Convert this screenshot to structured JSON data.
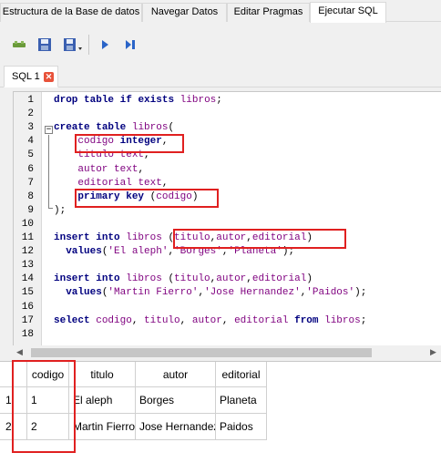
{
  "main_tabs": [
    {
      "label": "Estructura de la Base de datos"
    },
    {
      "label": "Navegar Datos"
    },
    {
      "label": "Editar Pragmas"
    },
    {
      "label": "Ejecutar SQL",
      "active": true
    }
  ],
  "toolbar": {
    "icons": [
      "open-tab-icon",
      "open-sql-icon",
      "save-sql-icon",
      "execute-all-icon",
      "execute-line-icon"
    ]
  },
  "sql_tab": {
    "label": "SQL 1"
  },
  "editor": {
    "line_numbers": [
      "1",
      "2",
      "3",
      "4",
      "5",
      "6",
      "7",
      "8",
      "9",
      "10",
      "11",
      "12",
      "13",
      "14",
      "15",
      "16",
      "17",
      "18"
    ],
    "lines": [
      [
        {
          "t": "drop",
          "c": "kw"
        },
        {
          "t": " "
        },
        {
          "t": "table",
          "c": "kw"
        },
        {
          "t": " "
        },
        {
          "t": "if",
          "c": "kw"
        },
        {
          "t": " "
        },
        {
          "t": "exists",
          "c": "kw"
        },
        {
          "t": " "
        },
        {
          "t": "libros",
          "c": "id"
        },
        {
          "t": ";"
        }
      ],
      [],
      [
        {
          "t": "create",
          "c": "kw"
        },
        {
          "t": " "
        },
        {
          "t": "table",
          "c": "kw"
        },
        {
          "t": " "
        },
        {
          "t": "libros",
          "c": "id"
        },
        {
          "t": "("
        }
      ],
      [
        {
          "t": "    "
        },
        {
          "t": "codigo",
          "c": "id"
        },
        {
          "t": " "
        },
        {
          "t": "integer",
          "c": "kw"
        },
        {
          "t": ","
        }
      ],
      [
        {
          "t": "    "
        },
        {
          "t": "titulo",
          "c": "id"
        },
        {
          "t": " "
        },
        {
          "t": "text",
          "c": "id"
        },
        {
          "t": ","
        }
      ],
      [
        {
          "t": "    "
        },
        {
          "t": "autor",
          "c": "id"
        },
        {
          "t": " "
        },
        {
          "t": "text",
          "c": "id"
        },
        {
          "t": ","
        }
      ],
      [
        {
          "t": "    "
        },
        {
          "t": "editorial",
          "c": "id"
        },
        {
          "t": " "
        },
        {
          "t": "text",
          "c": "id"
        },
        {
          "t": ","
        }
      ],
      [
        {
          "t": "    "
        },
        {
          "t": "primary",
          "c": "kw"
        },
        {
          "t": " "
        },
        {
          "t": "key",
          "c": "kw"
        },
        {
          "t": " ("
        },
        {
          "t": "codigo",
          "c": "id"
        },
        {
          "t": ")"
        }
      ],
      [
        {
          "t": ");"
        }
      ],
      [],
      [
        {
          "t": "insert",
          "c": "kw"
        },
        {
          "t": " "
        },
        {
          "t": "into",
          "c": "kw"
        },
        {
          "t": " "
        },
        {
          "t": "libros",
          "c": "id"
        },
        {
          "t": " ("
        },
        {
          "t": "titulo",
          "c": "id"
        },
        {
          "t": ","
        },
        {
          "t": "autor",
          "c": "id"
        },
        {
          "t": ","
        },
        {
          "t": "editorial",
          "c": "id"
        },
        {
          "t": ")"
        }
      ],
      [
        {
          "t": "  "
        },
        {
          "t": "values",
          "c": "kw"
        },
        {
          "t": "("
        },
        {
          "t": "'El aleph'",
          "c": "str"
        },
        {
          "t": ","
        },
        {
          "t": "'Borges'",
          "c": "str"
        },
        {
          "t": ","
        },
        {
          "t": "'Planeta'",
          "c": "str"
        },
        {
          "t": ");"
        }
      ],
      [],
      [
        {
          "t": "insert",
          "c": "kw"
        },
        {
          "t": " "
        },
        {
          "t": "into",
          "c": "kw"
        },
        {
          "t": " "
        },
        {
          "t": "libros",
          "c": "id"
        },
        {
          "t": " ("
        },
        {
          "t": "titulo",
          "c": "id"
        },
        {
          "t": ","
        },
        {
          "t": "autor",
          "c": "id"
        },
        {
          "t": ","
        },
        {
          "t": "editorial",
          "c": "id"
        },
        {
          "t": ")"
        }
      ],
      [
        {
          "t": "  "
        },
        {
          "t": "values",
          "c": "kw"
        },
        {
          "t": "("
        },
        {
          "t": "'Martin Fierro'",
          "c": "str"
        },
        {
          "t": ","
        },
        {
          "t": "'Jose Hernandez'",
          "c": "str"
        },
        {
          "t": ","
        },
        {
          "t": "'Paidos'",
          "c": "str"
        },
        {
          "t": ");"
        }
      ],
      [],
      [
        {
          "t": "select",
          "c": "kw"
        },
        {
          "t": " "
        },
        {
          "t": "codigo",
          "c": "id"
        },
        {
          "t": ", "
        },
        {
          "t": "titulo",
          "c": "id"
        },
        {
          "t": ", "
        },
        {
          "t": "autor",
          "c": "id"
        },
        {
          "t": ", "
        },
        {
          "t": "editorial",
          "c": "id"
        },
        {
          "t": " "
        },
        {
          "t": "from",
          "c": "kw"
        },
        {
          "t": " "
        },
        {
          "t": "libros",
          "c": "id"
        },
        {
          "t": ";"
        }
      ],
      []
    ]
  },
  "results": {
    "columns": [
      "codigo",
      "titulo",
      "autor",
      "editorial"
    ],
    "rows": [
      {
        "row_number": "1",
        "cells": [
          "1",
          "El aleph",
          "Borges",
          "Planeta"
        ]
      },
      {
        "row_number": "2",
        "cells": [
          "2",
          "Martin Fierro",
          "Jose Hernandez",
          "Paidos"
        ]
      }
    ]
  },
  "colors": {
    "keyword": "#00007f",
    "identifier": "#7f007f",
    "highlight_box": "#e02020"
  }
}
